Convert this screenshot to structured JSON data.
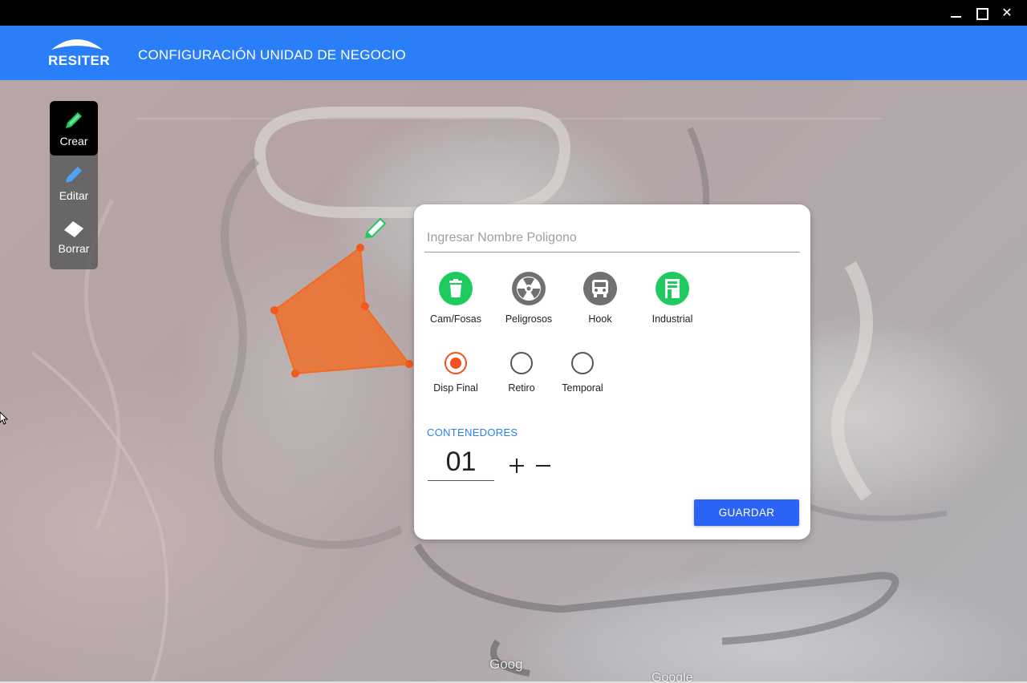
{
  "window": {
    "minimize_icon": "minimize-icon",
    "maximize_icon": "maximize-icon",
    "close_icon": "close-icon"
  },
  "appbar": {
    "logo_text": "RESITER",
    "title": "CONFIGURACIÓN UNIDAD DE NEGOCIO",
    "color": "#2a7ff8"
  },
  "toolbox": {
    "items": [
      {
        "label": "Crear",
        "icon": "pencil-icon",
        "active": true
      },
      {
        "label": "Editar",
        "icon": "pencil-icon",
        "active": false
      },
      {
        "label": "Borrar",
        "icon": "eraser-icon",
        "active": false
      }
    ]
  },
  "map": {
    "attribution": [
      "Goog",
      "Google"
    ],
    "polygon_color": "#f26b23"
  },
  "panel": {
    "name_placeholder": "Ingresar Nombre Poligono",
    "name_value": "",
    "types": [
      {
        "label": "Cam/Fosas",
        "icon": "trash-icon",
        "selected": true,
        "color": "#1ecb5e"
      },
      {
        "label": "Peligrosos",
        "icon": "radiation-icon",
        "selected": false,
        "color": "#707070"
      },
      {
        "label": "Hook",
        "icon": "truck-icon",
        "selected": false,
        "color": "#707070"
      },
      {
        "label": "Industrial",
        "icon": "factory-icon",
        "selected": true,
        "color": "#1ecb5e"
      }
    ],
    "disposal": [
      {
        "label": "Disp Final",
        "checked": true
      },
      {
        "label": "Retiro",
        "checked": false
      },
      {
        "label": "Temporal",
        "checked": false
      }
    ],
    "containers_label": "CONTENEDORES",
    "containers_count": "01",
    "save_label": "GUARDAR",
    "accent": "#f4511e",
    "save_color": "#2a63f6"
  }
}
